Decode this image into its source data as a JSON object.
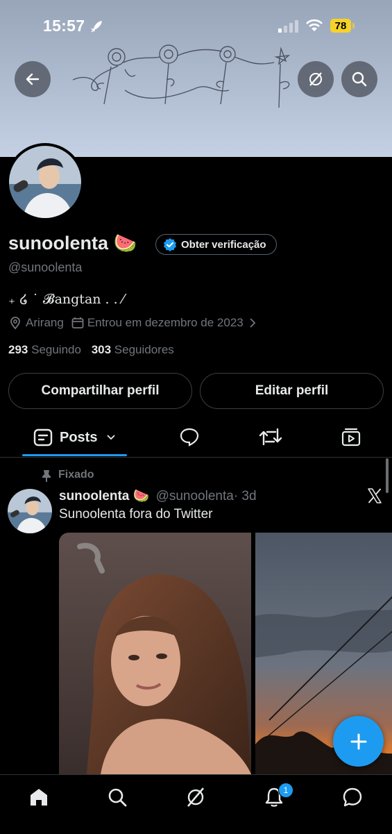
{
  "status_bar": {
    "time": "15:57",
    "battery": "78"
  },
  "profile": {
    "name": "sunoolenta 🍉",
    "verify_label": "Obter verificação",
    "handle": "@sunoolenta",
    "bio": "₊ ໒ ˙ 𝓑angtan . . ⁄",
    "location": "Arirang",
    "joined": "Entrou em dezembro de 2023",
    "following_count": "293",
    "following_label": "Seguindo",
    "followers_count": "303",
    "followers_label": "Seguidores"
  },
  "buttons": {
    "share": "Compartilhar perfil",
    "edit": "Editar perfil"
  },
  "tabs": {
    "posts": "Posts"
  },
  "pinned_post": {
    "pinned_label": "Fixado",
    "author": "sunoolenta 🍉",
    "handle": "@sunoolenta",
    "time": "· 3d",
    "text": "Sunoolenta fora do Twitter"
  },
  "notifications_badge": "1",
  "colors": {
    "accent": "#1d9bf0",
    "background": "#000000",
    "secondary_text": "#71767b"
  },
  "icons": [
    "back-arrow-icon",
    "grok-icon",
    "search-icon",
    "location-icon",
    "calendar-icon",
    "pin-icon",
    "x-logo-icon",
    "home-icon",
    "notifications-icon",
    "messages-icon",
    "plus-icon"
  ]
}
